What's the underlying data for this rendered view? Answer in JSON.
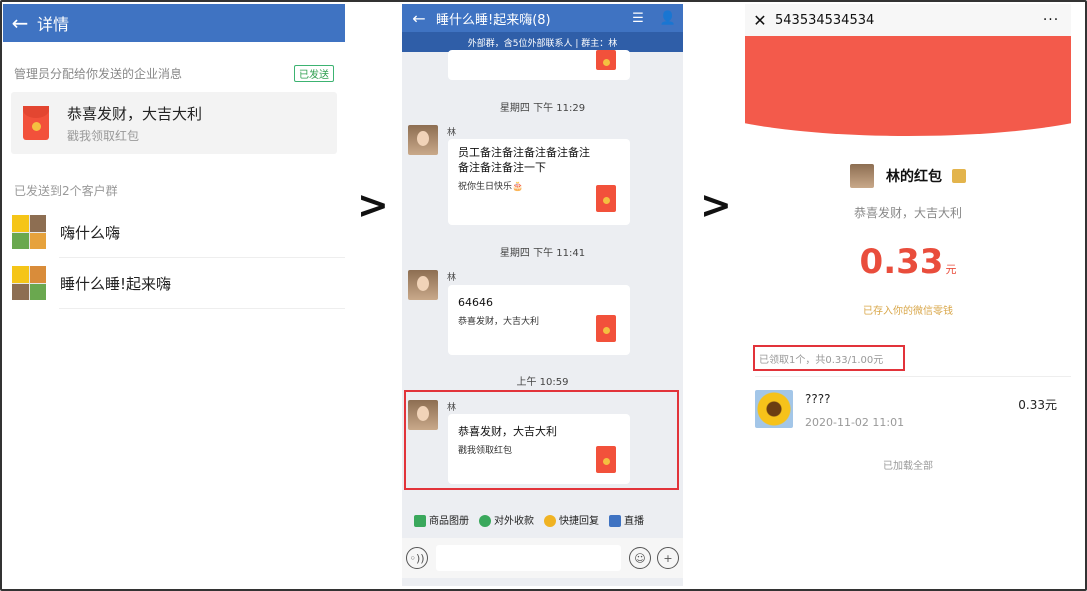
{
  "panel1": {
    "title": "详情",
    "section_label": "管理员分配给你发送的企业消息",
    "sent_badge": "已发送",
    "message": {
      "title": "恭喜发财，大吉大利",
      "subtitle": "戳我领取红包"
    },
    "groups_label": "已发送到2个客户群",
    "groups": [
      {
        "name": "嗨什么嗨"
      },
      {
        "name": "睡什么睡!起来嗨"
      }
    ]
  },
  "arrows": [
    ">",
    ">"
  ],
  "panel2": {
    "title": "睡什么睡!起来嗨(8)",
    "banner": "外部群，含5位外部联系人 | 群主：林",
    "time1": "星期四 下午 11:29",
    "msg1": {
      "sender": "林",
      "title": "员工备注备注备注备注备注备注备注备注一下",
      "sub": "祝你生日快乐🎂"
    },
    "time2": "星期四 下午 11:41",
    "msg2": {
      "sender": "林",
      "title": "64646",
      "sub": "恭喜发财，大吉大利"
    },
    "time3": "上午 10:59",
    "msg3": {
      "sender": "林",
      "title": "恭喜发财，大吉大利",
      "sub": "戳我领取红包"
    },
    "tools": [
      "商品图册",
      "对外收款",
      "快捷回复",
      "直播"
    ],
    "tool_colors": [
      "#3aa85c",
      "#3aa85c",
      "#f0b323",
      "#3f73c2"
    ]
  },
  "panel3": {
    "number": "543534534534",
    "more": "···",
    "sender_name": "林的红包",
    "greeting": "恭喜发财，大吉大利",
    "amount": "0.33",
    "unit": "元",
    "saved_note": "已存入你的微信零钱",
    "received_summary": "已领取1个，共0.33/1.00元",
    "record": {
      "name": "????",
      "time": "2020-11-02 11:01",
      "amount": "0.33元"
    },
    "loaded_all": "已加载全部"
  },
  "colors": {
    "header_blue": "#3f73c2",
    "red_packet": "#f2513b",
    "highlight_red": "#e2333a"
  }
}
